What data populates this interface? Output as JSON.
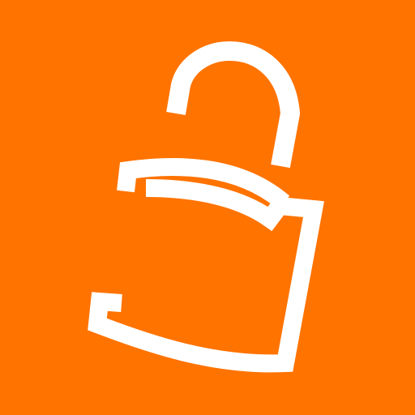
{
  "icon": {
    "name": "open-padlock-icon",
    "background_color": "#FF7300",
    "stroke_color": "#FFFFFF"
  }
}
